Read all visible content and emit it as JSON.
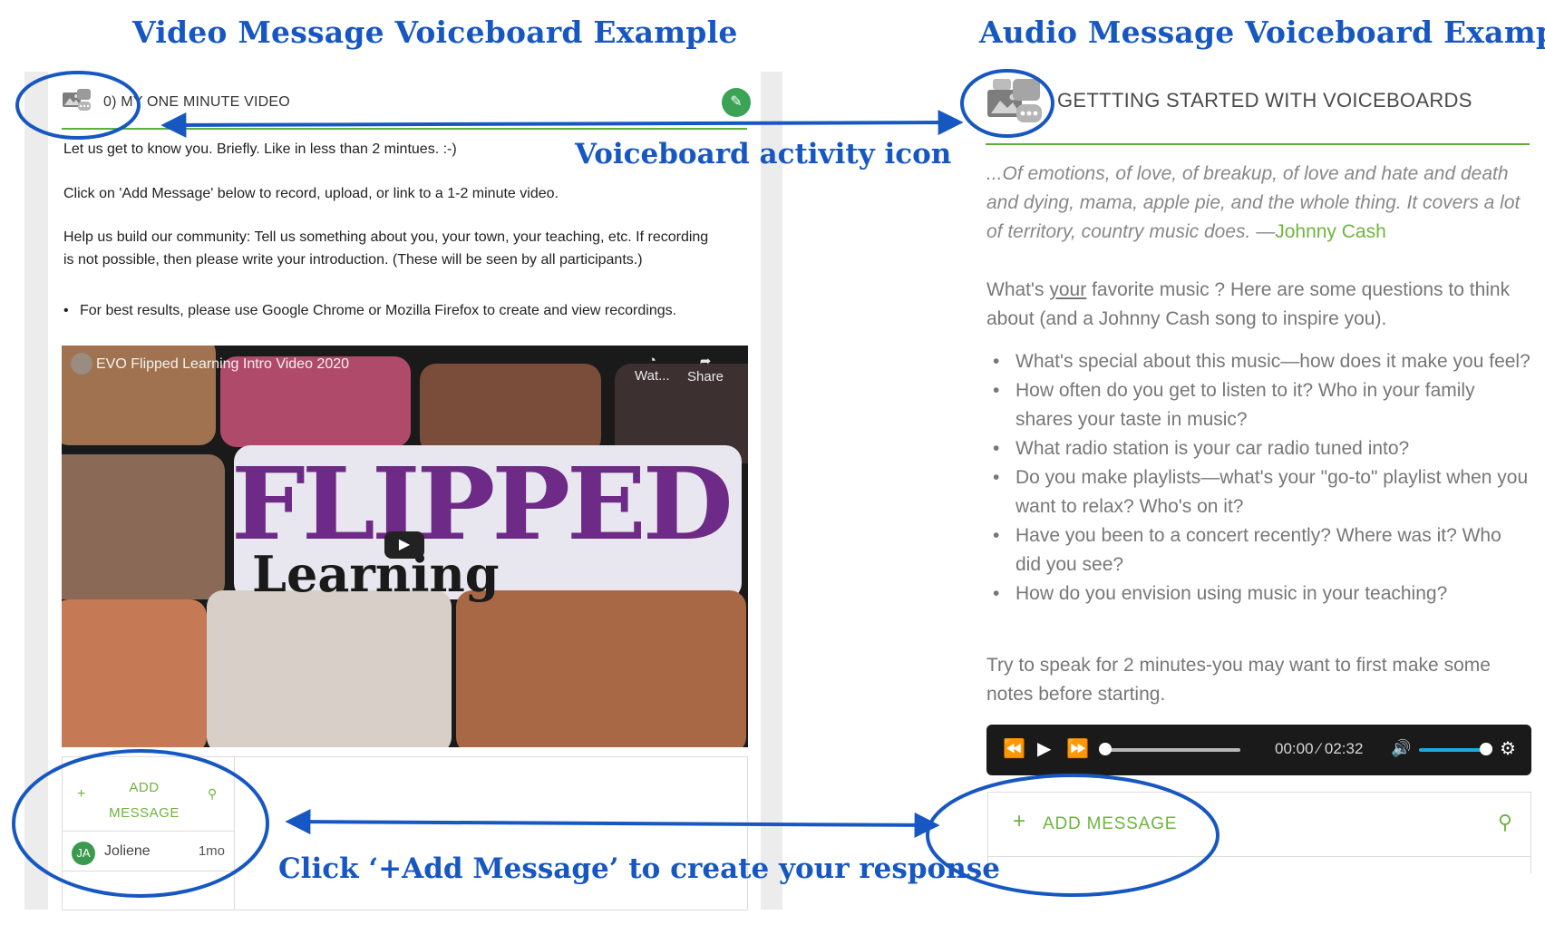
{
  "headings": {
    "left": "Video Message Voiceboard Example",
    "right": "Audio Message Voiceboard Example"
  },
  "callouts": {
    "activity_icon": "Voiceboard activity icon",
    "add_message": "Click ‘+Add Message’ to create your response"
  },
  "video_board": {
    "title": "0) MY ONE MINUTE VIDEO",
    "instructions": [
      "Let us get to know you. Briefly. Like in less than 2 mintues. :-)",
      "Click on 'Add Message' below to record, upload, or link to a 1-2 minute video.",
      "Help us build our community: Tell us something about you, your town, your teaching, etc. If recording is not possible, then please write your introduction. (These will be seen by all participants.)"
    ],
    "bullet": "For best results, please use Google Chrome or Mozilla Firefox to create and view recordings.",
    "video": {
      "title": "EVO Flipped Learning Intro Video 2020",
      "watch_label": "Wat...",
      "share_label": "Share",
      "overlay_word": "FLIPPED",
      "overlay_word2": "Learning"
    },
    "add_message_label": "ADD MESSAGE",
    "messages": [
      {
        "initials": "JA",
        "name": "Joliene",
        "time": "1mo"
      }
    ]
  },
  "audio_board": {
    "title": "GETTTING STARTED WITH VOICEBOARDS",
    "quote": "...Of emotions, of love, of breakup, of love and hate and death and dying, mama, apple pie, and the whole thing. It covers a lot of territory, country music does. —",
    "quote_author": "Johnny Cash",
    "prompt_pre": "What's ",
    "prompt_underlined": "your",
    "prompt_post": " favorite music ?  Here are some questions to think about (and a Johnny Cash song to inspire you).",
    "questions": [
      "What's special about this music—how does it make you feel?",
      "How often do you get to listen to it? Who in your family shares your taste in music?",
      "What radio station is your car radio tuned into?",
      "Do you make playlists—what's your \"go-to\" playlist when you want to relax? Who's on it?",
      "Have you been to a concert recently? Where was it? Who did you see?",
      "How do you envision using music in your teaching?"
    ],
    "closing": "Try to speak for 2 minutes-you may want to first make some notes before starting.",
    "player": {
      "current_time": "00:00",
      "separator": "⁄",
      "duration": "02:32",
      "progress": 0,
      "volume": 0.9
    },
    "add_message_label": "ADD MESSAGE"
  },
  "colors": {
    "annotation_blue": "#1757c2",
    "brand_green": "#6fb43f"
  }
}
